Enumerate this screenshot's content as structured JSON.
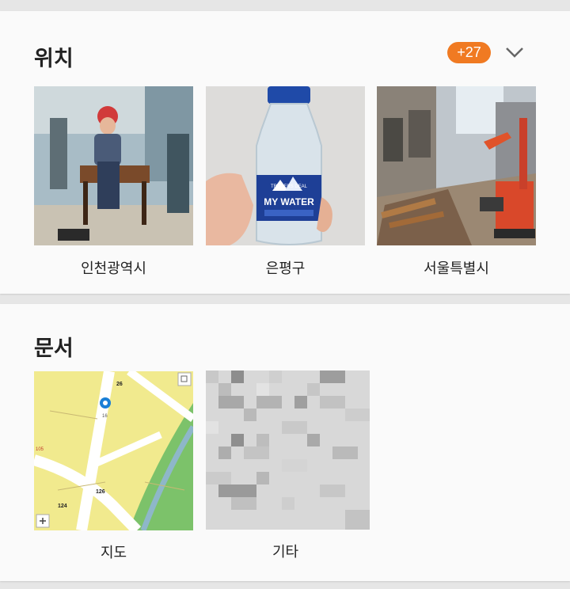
{
  "location": {
    "title": "위치",
    "badge": "+27",
    "expand_icon": "chevron-down-icon",
    "items": [
      {
        "label": "인천광역시"
      },
      {
        "label": "은평구",
        "photo_text_brand": "TRADERS DEAL",
        "photo_text_main": "MY WATER"
      },
      {
        "label": "서울특별시"
      }
    ]
  },
  "documents": {
    "title": "문서",
    "items": [
      {
        "label": "지도",
        "map_numbers": [
          "26",
          "16",
          "126",
          "124",
          "105"
        ],
        "zoom_icon": "plus-icon"
      },
      {
        "label": "기타"
      }
    ]
  },
  "colors": {
    "accent": "#f07a22",
    "card_bg": "#fafafa",
    "page_bg": "#e6e6e6"
  }
}
